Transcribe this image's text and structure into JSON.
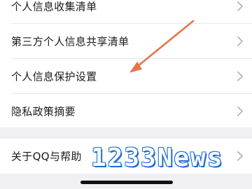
{
  "settings_list": {
    "items": [
      {
        "label": "个人信息收集清单"
      },
      {
        "label": "第三方个人信息共享清单"
      },
      {
        "label": "个人信息保护设置"
      },
      {
        "label": "隐私政策摘要"
      }
    ]
  },
  "about_section": {
    "label": "关于QQ与帮助"
  },
  "watermark": {
    "text": "1233News"
  },
  "icons": {
    "row_chevron": "chevron-right-icon",
    "annotation": "arrow-icon"
  },
  "colors": {
    "annotation_arrow": "#e8744a",
    "watermark_blue": "#1d6bd6"
  }
}
